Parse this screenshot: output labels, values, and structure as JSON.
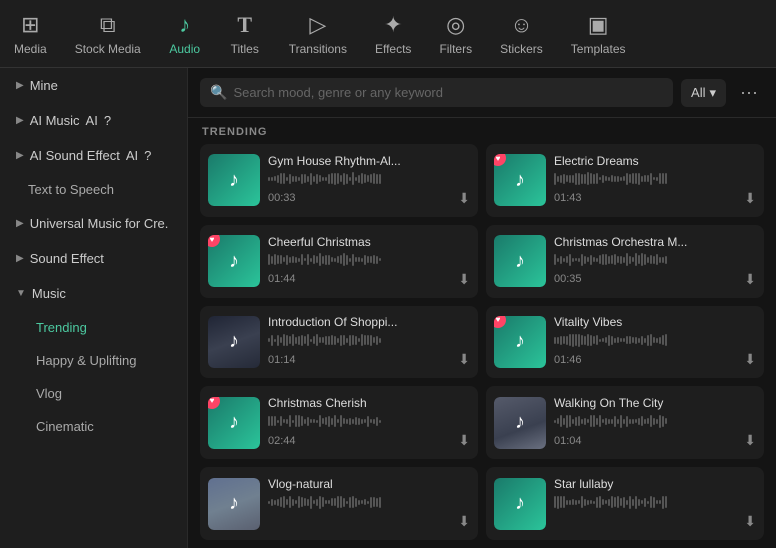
{
  "toolbar": {
    "items": [
      {
        "id": "media",
        "label": "Media",
        "icon": "⊞",
        "active": false
      },
      {
        "id": "stock-media",
        "label": "Stock Media",
        "icon": "⧉",
        "active": false
      },
      {
        "id": "audio",
        "label": "Audio",
        "icon": "♪",
        "active": true
      },
      {
        "id": "titles",
        "label": "Titles",
        "icon": "T",
        "active": false
      },
      {
        "id": "transitions",
        "label": "Transitions",
        "icon": "▷",
        "active": false
      },
      {
        "id": "effects",
        "label": "Effects",
        "icon": "✦",
        "active": false
      },
      {
        "id": "filters",
        "label": "Filters",
        "icon": "◎",
        "active": false
      },
      {
        "id": "stickers",
        "label": "Stickers",
        "icon": "☺",
        "active": false
      },
      {
        "id": "templates",
        "label": "Templates",
        "icon": "▣",
        "active": false
      }
    ]
  },
  "sidebar": {
    "items": [
      {
        "id": "mine",
        "label": "Mine",
        "type": "collapsible",
        "expanded": false
      },
      {
        "id": "ai-music",
        "label": "AI Music",
        "type": "collapsible",
        "expanded": false,
        "badge": "AI",
        "help": true
      },
      {
        "id": "ai-sound-effect",
        "label": "AI Sound Effect",
        "type": "collapsible",
        "expanded": false,
        "badge": "AI",
        "help": true
      },
      {
        "id": "text-to-speech",
        "label": "Text to Speech",
        "type": "simple",
        "indent": true
      },
      {
        "id": "universal-music",
        "label": "Universal Music for Cre.",
        "type": "collapsible",
        "expanded": false
      },
      {
        "id": "sound-effect",
        "label": "Sound Effect",
        "type": "collapsible",
        "expanded": false
      },
      {
        "id": "music",
        "label": "Music",
        "type": "section",
        "expanded": true
      },
      {
        "id": "trending",
        "label": "Trending",
        "type": "sub",
        "active": true
      },
      {
        "id": "happy-uplifting",
        "label": "Happy & Uplifting",
        "type": "sub",
        "active": false
      },
      {
        "id": "vlog",
        "label": "Vlog",
        "type": "sub",
        "active": false
      },
      {
        "id": "cinematic",
        "label": "Cinematic",
        "type": "sub",
        "active": false
      }
    ]
  },
  "search": {
    "placeholder": "Search mood, genre or any keyword",
    "filter_label": "All"
  },
  "trending": {
    "section_label": "TRENDING",
    "tracks": [
      {
        "id": "gym-house",
        "title": "Gym House Rhythm-Al...",
        "duration": "00:33",
        "thumb_style": "teal",
        "heart": false
      },
      {
        "id": "electric-dreams",
        "title": "Electric Dreams",
        "duration": "01:43",
        "thumb_style": "teal",
        "heart": true
      },
      {
        "id": "cheerful-christmas",
        "title": "Cheerful Christmas",
        "duration": "01:44",
        "thumb_style": "teal",
        "heart": true
      },
      {
        "id": "christmas-orchestra",
        "title": "Christmas Orchestra M...",
        "duration": "00:35",
        "thumb_style": "teal",
        "heart": false
      },
      {
        "id": "intro-shopping",
        "title": "Introduction Of Shoppi...",
        "duration": "01:14",
        "thumb_style": "photo-dark",
        "heart": false
      },
      {
        "id": "vitality-vibes",
        "title": "Vitality Vibes",
        "duration": "01:46",
        "thumb_style": "teal",
        "heart": true
      },
      {
        "id": "christmas-cherish",
        "title": "Christmas Cherish",
        "duration": "02:44",
        "thumb_style": "teal",
        "heart": true
      },
      {
        "id": "walking-city",
        "title": "Walking On The City",
        "duration": "01:04",
        "thumb_style": "photo-city",
        "heart": false
      },
      {
        "id": "vlog-natural",
        "title": "Vlog-natural",
        "duration": "",
        "thumb_style": "photo-sky",
        "heart": false
      },
      {
        "id": "star-lullaby",
        "title": "Star lullaby",
        "duration": "",
        "thumb_style": "teal",
        "heart": false
      }
    ]
  }
}
